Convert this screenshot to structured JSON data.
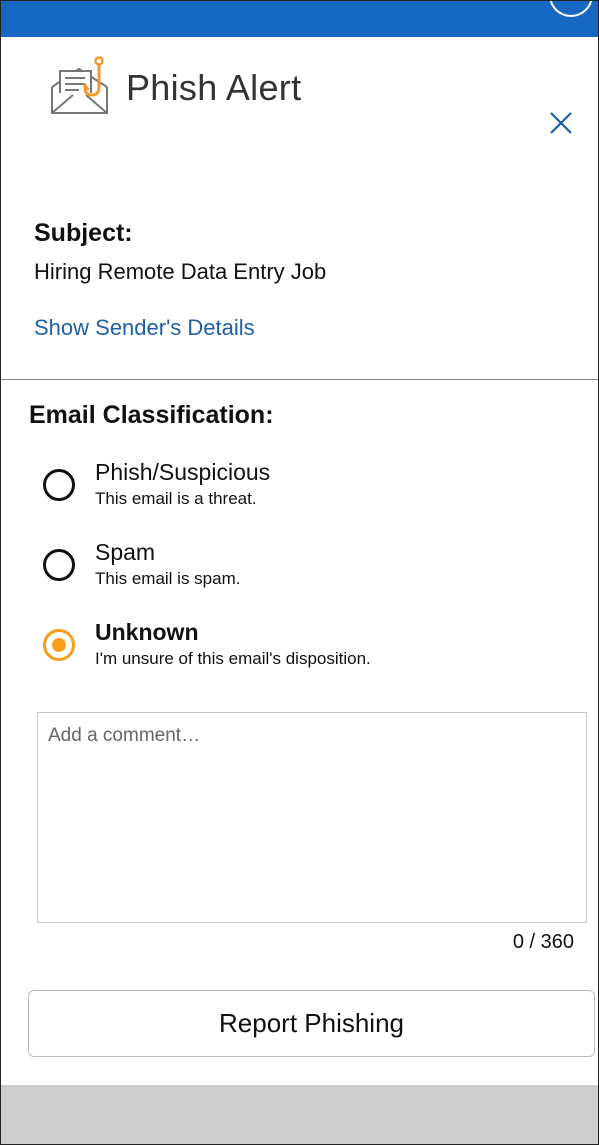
{
  "header": {
    "title": "Phish Alert",
    "logo_icon": "envelope-hook-icon",
    "close_icon": "close-icon",
    "accent_color": "#1668c2",
    "hook_color": "#f29a2e"
  },
  "email": {
    "subject_label": "Subject:",
    "subject_value": "Hiring Remote Data Entry Job",
    "show_sender_link": "Show Sender's Details"
  },
  "classification": {
    "label": "Email Classification:",
    "selected": "unknown",
    "selected_color": "#f6a01a",
    "options": [
      {
        "id": "phish",
        "title": "Phish/Suspicious",
        "description": "This email is a threat."
      },
      {
        "id": "spam",
        "title": "Spam",
        "description": "This email is spam."
      },
      {
        "id": "unknown",
        "title": "Unknown",
        "description": "I'm unsure of this email's disposition."
      }
    ]
  },
  "comment": {
    "placeholder": "Add a comment…",
    "value": "",
    "counter": "0 / 360"
  },
  "actions": {
    "report_label": "Report Phishing"
  }
}
